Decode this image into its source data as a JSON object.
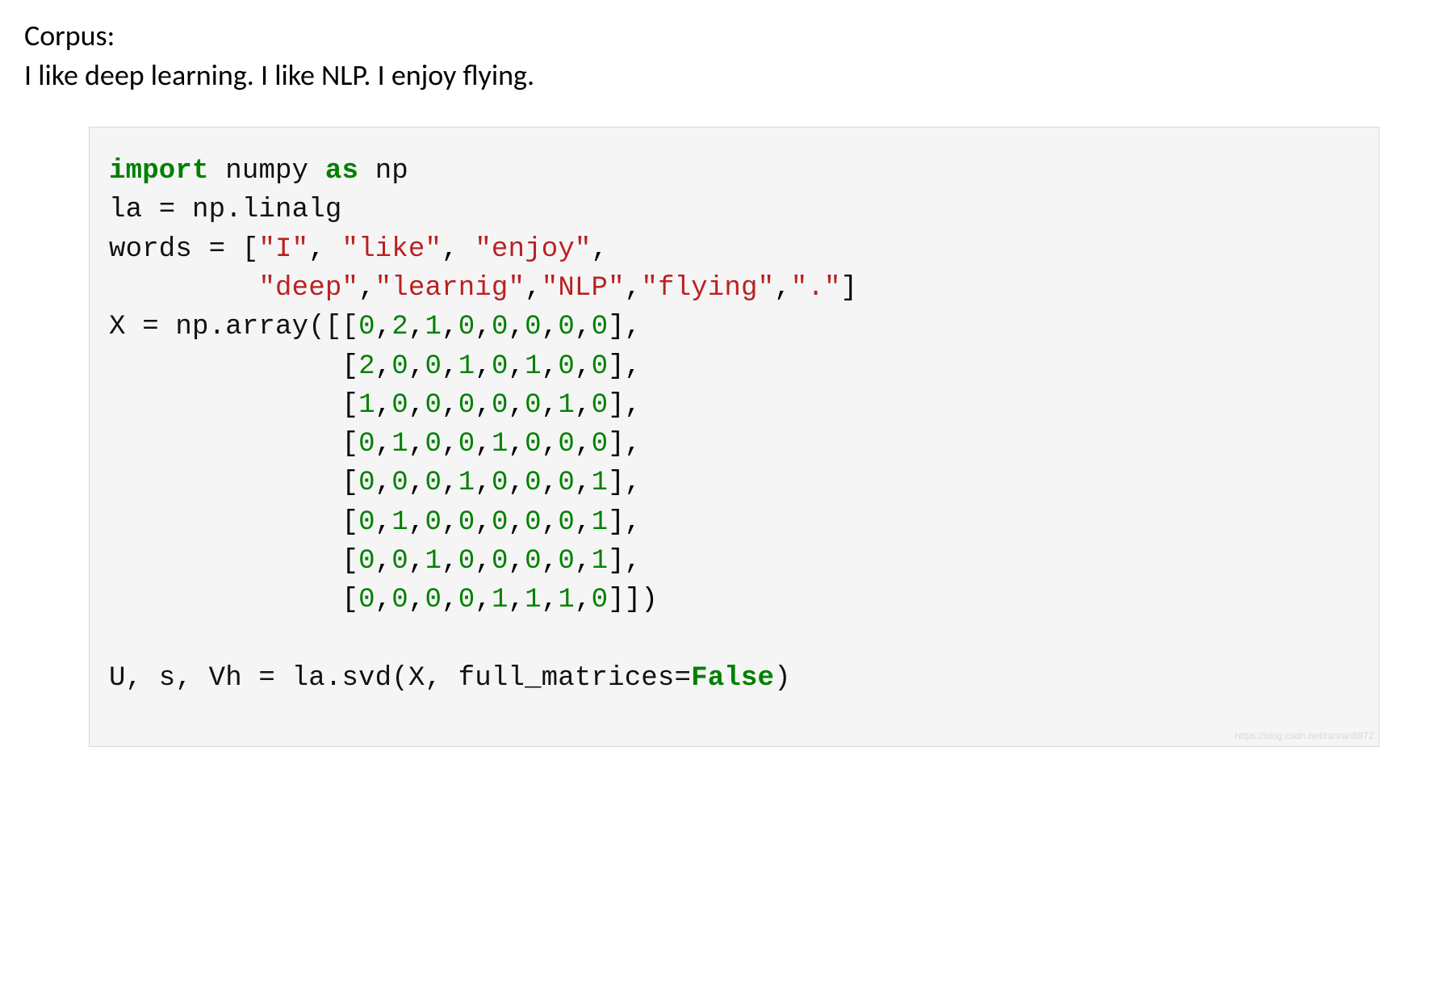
{
  "header": {
    "label": "Corpus:",
    "text": "I like deep learning. I like NLP. I enjoy flying."
  },
  "code": {
    "line1_import": "import",
    "line1_numpy": "numpy",
    "line1_as": "as",
    "line1_np": "np",
    "line2": "la = np.linalg",
    "line3_words_eq": "words = [",
    "line3_s1": "\"I\"",
    "line3_s2": "\"like\"",
    "line3_s3": "\"enjoy\"",
    "line4_indent": "         ",
    "line4_s1": "\"deep\"",
    "line4_s2": "\"learnig\"",
    "line4_s3": "\"NLP\"",
    "line4_s4": "\"flying\"",
    "line4_s5": "\".\"",
    "line5_prefix": "X = np.array([[",
    "row1": [
      "0",
      "2",
      "1",
      "0",
      "0",
      "0",
      "0",
      "0"
    ],
    "row2": [
      "2",
      "0",
      "0",
      "1",
      "0",
      "1",
      "0",
      "0"
    ],
    "row3": [
      "1",
      "0",
      "0",
      "0",
      "0",
      "0",
      "1",
      "0"
    ],
    "row4": [
      "0",
      "1",
      "0",
      "0",
      "1",
      "0",
      "0",
      "0"
    ],
    "row5": [
      "0",
      "0",
      "0",
      "1",
      "0",
      "0",
      "0",
      "1"
    ],
    "row6": [
      "0",
      "1",
      "0",
      "0",
      "0",
      "0",
      "0",
      "1"
    ],
    "row7": [
      "0",
      "0",
      "1",
      "0",
      "0",
      "0",
      "0",
      "1"
    ],
    "row8": [
      "0",
      "0",
      "0",
      "0",
      "1",
      "1",
      "1",
      "0"
    ],
    "row_indent": "              [",
    "row_close": "],",
    "row_close_last": "]])",
    "svd_prefix": "U, s, Vh = la.svd(X, full_matrices=",
    "svd_false": "False",
    "svd_suffix": ")",
    "watermark": "https://blog.csdn.net/ranran8972"
  },
  "p": {
    "comma_sp": ", ",
    "comma": ",",
    "close_sq": "]"
  }
}
